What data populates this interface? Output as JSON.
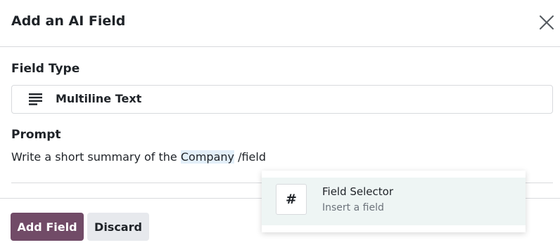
{
  "dialog": {
    "title": "Add an AI Field",
    "close_icon": "close-icon"
  },
  "field_type": {
    "label": "Field Type",
    "value": "Multiline Text",
    "icon": "lines-icon"
  },
  "prompt": {
    "label": "Prompt",
    "text_before": "Write a short summary of the ",
    "highlighted": "Company",
    "text_after": " /field"
  },
  "footer": {
    "add_label": "Add Field",
    "discard_label": "Discard"
  },
  "command_popover": {
    "item_icon": "#",
    "item_title": "Field Selector",
    "item_description": "Insert a field"
  },
  "colors": {
    "primary": "#714b67",
    "highlight": "#e3eff9",
    "popover_active": "#eef5f4"
  }
}
